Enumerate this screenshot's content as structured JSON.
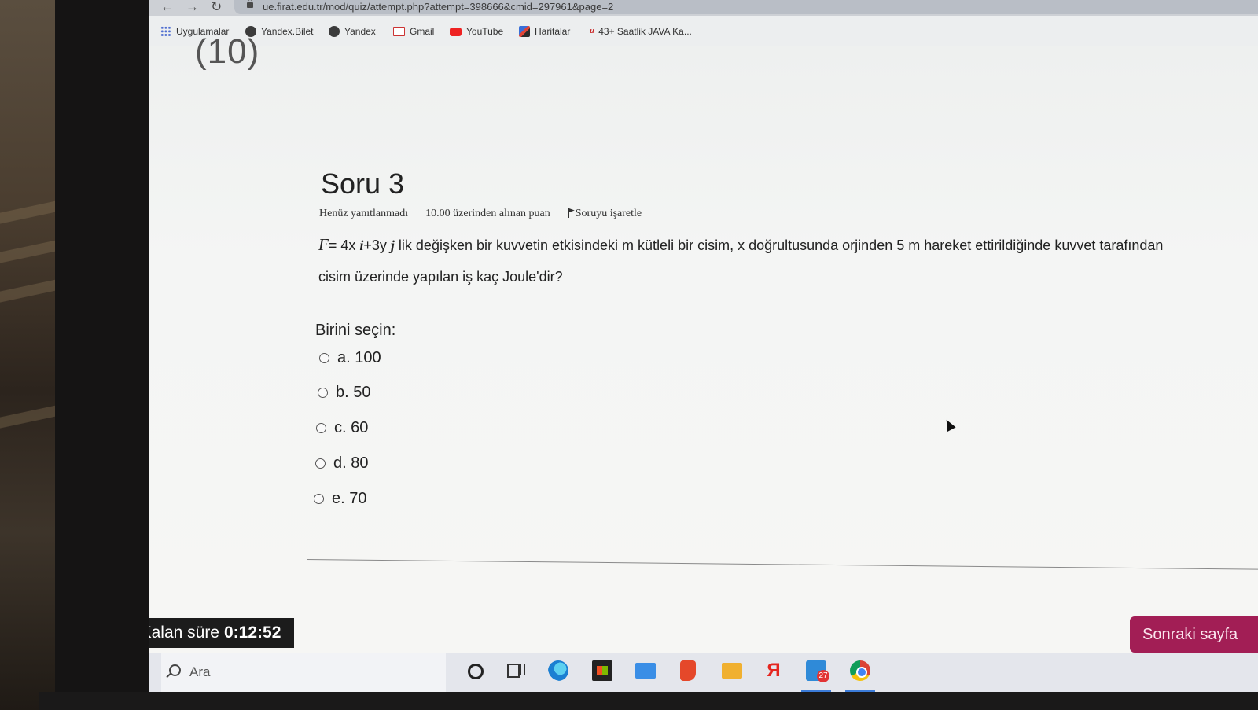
{
  "browser": {
    "nav": {
      "back": "←",
      "forward": "→",
      "reload": "↻"
    },
    "url": "ue.firat.edu.tr/mod/quiz/attempt.php?attempt=398666&cmid=297961&page=2",
    "bookmarks": [
      {
        "label": "Uygulamalar",
        "icon": "apps-grid-icon"
      },
      {
        "label": "Yandex.Bilet",
        "icon": "globe-icon"
      },
      {
        "label": "Yandex",
        "icon": "globe-icon"
      },
      {
        "label": "Gmail",
        "icon": "gmail-icon"
      },
      {
        "label": "YouTube",
        "icon": "youtube-icon"
      },
      {
        "label": "Haritalar",
        "icon": "maps-icon"
      },
      {
        "label": "43+ Saatlik JAVA Ka...",
        "icon": "udemy-icon"
      }
    ]
  },
  "page": {
    "top_partial": "(10)",
    "question": {
      "title": "Soru 3",
      "status": "Henüz yanıtlanmadı",
      "points": "10.00 üzerinden alınan puan",
      "flag_label": "Soruyu işaretle",
      "text_part1": "= 4x ",
      "text_i": "i",
      "text_part2": "+3y ",
      "text_j": "j",
      "text_part3": " lik değişken bir kuvvetin etkisindeki m kütleli bir cisim, x doğrultusunda orjinden 5 m hareket ettirildiğinde kuvvet tarafından cisim üzerinde yapılan iş kaç Joule'dir?",
      "symbol": "F"
    },
    "prompt": "Birini seçin:",
    "options": [
      {
        "label": "a. 100"
      },
      {
        "label": "b. 50"
      },
      {
        "label": "c. 60"
      },
      {
        "label": "d. 80"
      },
      {
        "label": "e. 70"
      }
    ],
    "timer": {
      "label": "Kalan süre",
      "value": "0:12:52"
    },
    "next_button": "Sonraki sayfa"
  },
  "taskbar": {
    "search_placeholder": "Ara",
    "chat_badge": "27",
    "apps": [
      "cortana-icon",
      "task-view-icon",
      "edge-icon",
      "store-icon",
      "mail-icon",
      "office-icon",
      "file-explorer-icon",
      "yandex-browser-icon",
      "chat-icon",
      "chrome-icon"
    ]
  }
}
